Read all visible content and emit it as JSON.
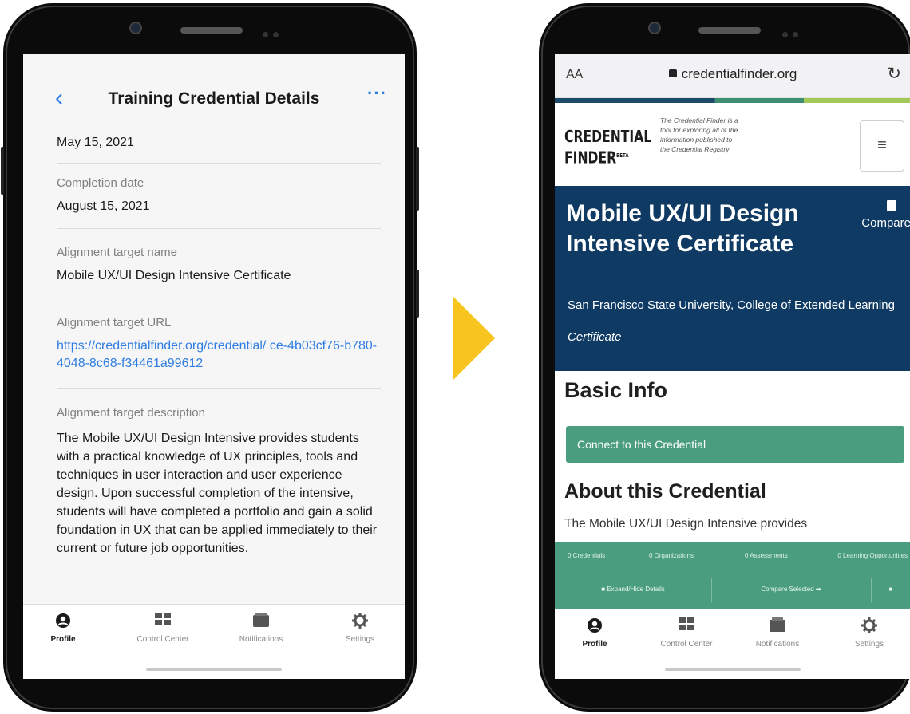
{
  "left_phone": {
    "nav": {
      "title": "Training Credential Details",
      "back_icon": "chevron-left-icon",
      "more_label": "···"
    },
    "fields": [
      {
        "label": "",
        "value": "May 15, 2021"
      },
      {
        "label": "Completion date",
        "value": "August 15, 2021"
      },
      {
        "label": "Alignment target name",
        "value": "Mobile UX/UI Design Intensive Certificate"
      },
      {
        "label": "Alignment target URL",
        "value": "https://credentialfinder.org/credential/ ce-4b03cf76-b780-4048-8c68-f34461a99612"
      }
    ],
    "description": {
      "label": "Alignment target description",
      "value": "The Mobile UX/UI Design Intensive provides students with a practical knowledge of UX principles, tools and techniques in user interaction and user experience design. Upon successful completion of the intensive, students will have completed a portfolio and gain a solid foundation in UX that can be applied immediately to their current or future job opportunities."
    }
  },
  "tabbar": {
    "items": [
      {
        "label": "Profile",
        "icon": "profile-icon"
      },
      {
        "label": "Control Center",
        "icon": "grid-icon"
      },
      {
        "label": "Notifications",
        "icon": "inbox-icon"
      },
      {
        "label": "Settings",
        "icon": "gear-icon"
      }
    ],
    "active": "Profile"
  },
  "right_phone": {
    "browser": {
      "text_size_label": "AA",
      "url": "credentialfinder.org"
    },
    "site": {
      "logo_line1": "CREDENTIAL",
      "logo_line2": "FINDER",
      "logo_beta": "BETA",
      "tagline": "The Credential Finder is a tool for exploring all of the information published to the Credential Registry"
    },
    "hero": {
      "title": "Mobile UX/UI Design Intensive Certificate",
      "compare_label": "Compare",
      "organization": "San Francisco State University, College of Extended Learning",
      "type": "Certificate"
    },
    "basic_info_heading": "Basic Info",
    "connect_button": "Connect to this Credential",
    "about_heading": "About this Credential",
    "about_text": "The Mobile UX/UI Design Intensive provides",
    "compare_bar": {
      "stats": [
        "0 Credentials",
        "0 Organizations",
        "0 Assessments",
        "0 Learning Opportunities"
      ],
      "buttons": [
        "Expand/Hide Details",
        "Compare Selected"
      ]
    }
  },
  "colors": {
    "accent": "#2f7de1",
    "hero_bg": "#0e3a63",
    "green": "#4a9d7e",
    "arrow": "#f7c51e"
  }
}
